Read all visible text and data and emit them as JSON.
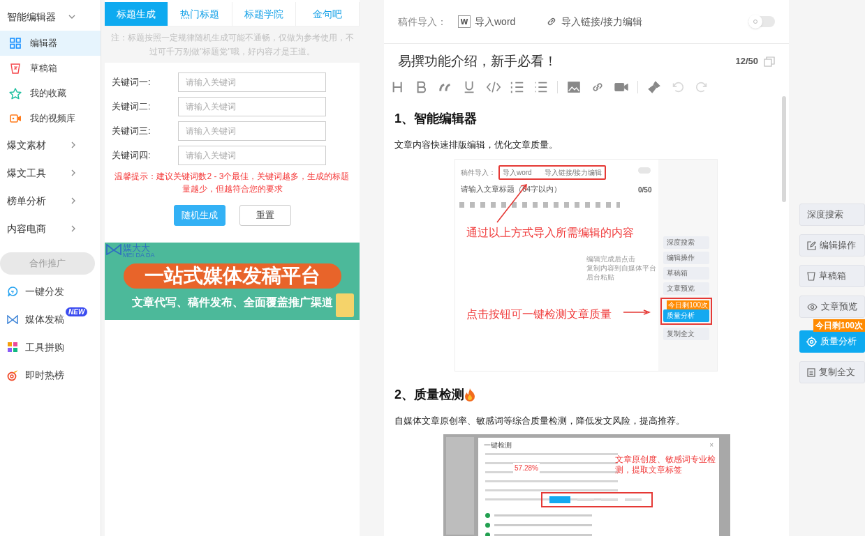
{
  "sidebar": {
    "items": [
      {
        "label": "智能编辑器",
        "kind": "group",
        "expanded": true,
        "children": [
          {
            "label": "编辑器",
            "selected": true
          },
          {
            "label": "草稿箱",
            "selected": false
          },
          {
            "label": "我的收藏",
            "selected": false
          },
          {
            "label": "我的视频库",
            "selected": false
          }
        ]
      },
      {
        "label": "爆文素材",
        "kind": "group",
        "expanded": false
      },
      {
        "label": "爆文工具",
        "kind": "group",
        "expanded": false
      },
      {
        "label": "榜单分析",
        "kind": "group",
        "expanded": false
      },
      {
        "label": "内容电商",
        "kind": "group",
        "expanded": false
      },
      {
        "label": "合作推广",
        "kind": "section"
      },
      {
        "label": "一键分发",
        "kind": "promo"
      },
      {
        "label": "媒体发稿",
        "kind": "promo",
        "badge": "NEW"
      },
      {
        "label": "工具拼购",
        "kind": "promo"
      },
      {
        "label": "即时热榜",
        "kind": "promo"
      }
    ]
  },
  "title_tool": {
    "tabs": [
      {
        "label": "标题生成",
        "selected": true
      },
      {
        "label": "热门标题",
        "selected": false
      },
      {
        "label": "标题学院",
        "selected": false
      },
      {
        "label": "金句吧",
        "selected": false
      }
    ],
    "note": "注：标题按照一定规律随机生成可能不通畅，仅做为参考使用，不过可千万别做\"标题党\"哦，好内容才是王道。",
    "keywords": [
      {
        "label": "关键词一:",
        "placeholder": "请输入关键词"
      },
      {
        "label": "关键词二:",
        "placeholder": "请输入关键词"
      },
      {
        "label": "关键词三:",
        "placeholder": "请输入关键词"
      },
      {
        "label": "关键词四:",
        "placeholder": "请输入关键词"
      }
    ],
    "tip": "温馨提示：建议关键词数2 - 3个最佳，关键词越多，生成的标题量越少，但越符合您的要求",
    "buttons": [
      {
        "label": "随机生成",
        "kind": "primary"
      },
      {
        "label": "重置",
        "kind": "secondary"
      }
    ]
  },
  "banner": {
    "brand": "媒大大",
    "brand_latin": "MEI DA DA",
    "headline": "一站式媒体发稿平台",
    "subline": "文章代写、稿件发布、全面覆盖推广渠道"
  },
  "editor": {
    "import_label": "稿件导入：",
    "import_word": "导入word",
    "word_icon_letter": "W",
    "import_link": "导入链接/接力编辑",
    "toggle": {
      "on": false
    },
    "title": "易撰功能介绍，新手必看！",
    "title_count": "12/50",
    "toolbar": [
      {
        "kind": "heading",
        "disabled": false
      },
      {
        "kind": "bold",
        "disabled": false
      },
      {
        "kind": "quote",
        "disabled": false
      },
      {
        "kind": "underline",
        "disabled": false
      },
      {
        "kind": "code",
        "disabled": false
      },
      {
        "kind": "ordered-list",
        "disabled": false
      },
      {
        "kind": "bullet-list",
        "disabled": false
      },
      {
        "kind": "separator"
      },
      {
        "kind": "image",
        "disabled": false
      },
      {
        "kind": "link",
        "disabled": false
      },
      {
        "kind": "video",
        "disabled": false
      },
      {
        "kind": "separator"
      },
      {
        "kind": "clear-format",
        "disabled": false
      },
      {
        "kind": "undo",
        "disabled": true
      },
      {
        "kind": "redo",
        "disabled": true
      }
    ],
    "content": [
      {
        "kind": "heading",
        "text": "1、智能编辑器"
      },
      {
        "kind": "paragraph",
        "text": "文章内容快速排版编辑，优化文章质量。"
      },
      {
        "kind": "guide_screenshot",
        "import_label": "稿件导入：",
        "import_word": "导入word",
        "import_link": "导入链接/接力编辑",
        "toggle_on": false,
        "title_placeholder": "请输入文章标题（64字以内）",
        "title_count": "0/50",
        "annotation_top": "通过以上方式导入所需编辑的内容",
        "note_lines": [
          "编辑完成后点击",
          "复制内容到自媒体平台",
          "后台粘贴"
        ],
        "buttons": [
          "深度搜索",
          "编辑操作",
          "草稿箱",
          "文章预览",
          "质量分析",
          "复制全文"
        ],
        "badge": "今日剩100次",
        "annotation_bottom": "点击按钮可一键检测文章质量"
      },
      {
        "kind": "heading",
        "text": "2、质量检测",
        "flame": true
      },
      {
        "kind": "paragraph",
        "text": "自媒体文章原创率、敏感词等综合质量检测，降低发文风险，提高推荐。"
      },
      {
        "kind": "modal_screenshot",
        "modal_title": "一键检测",
        "close": "×",
        "percent": "57.28%",
        "annotation": "文章原创度、敏感词专业检测，提取文章标签"
      }
    ]
  },
  "side_actions": [
    {
      "label": "深度搜索",
      "kind": "plain"
    },
    {
      "label": "编辑操作",
      "kind": "plain"
    },
    {
      "label": "草稿箱",
      "kind": "plain"
    },
    {
      "label": "文章预览",
      "kind": "plain"
    },
    {
      "label": "质量分析",
      "kind": "primary",
      "badge": "今日剩100次"
    },
    {
      "label": "复制全文",
      "kind": "plain"
    }
  ]
}
